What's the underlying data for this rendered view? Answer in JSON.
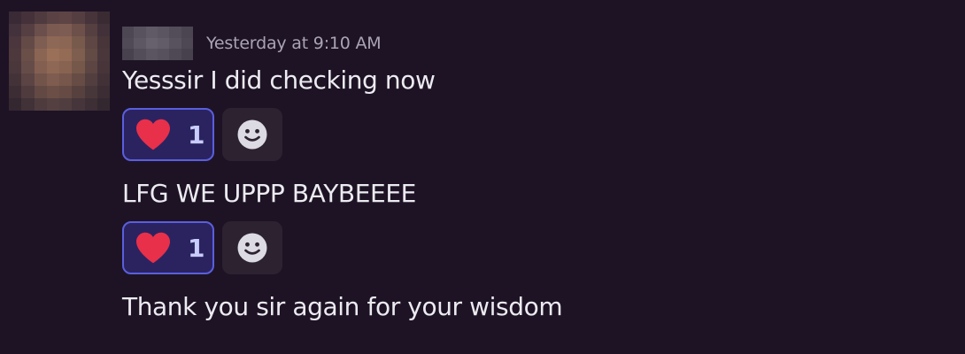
{
  "message_group": {
    "timestamp": "Yesterday at 9:10 AM",
    "messages": [
      {
        "text": "Yesssir I did checking now",
        "reaction": {
          "icon": "heart-icon",
          "count": "1",
          "color": "#e8304a"
        },
        "add_reaction_icon": "smiley-icon"
      },
      {
        "text": "LFG WE UPPP BAYBEEEE",
        "reaction": {
          "icon": "heart-icon",
          "count": "1",
          "color": "#e8304a"
        },
        "add_reaction_icon": "smiley-icon"
      },
      {
        "text": "Thank you sir again for your wisdom"
      }
    ]
  },
  "colors": {
    "background": "#1e1325",
    "reaction_border": "#5a5fdd",
    "reaction_bg": "#2b2360",
    "reaction_count": "#c9cdfb",
    "timestamp": "#a9a4b4"
  }
}
